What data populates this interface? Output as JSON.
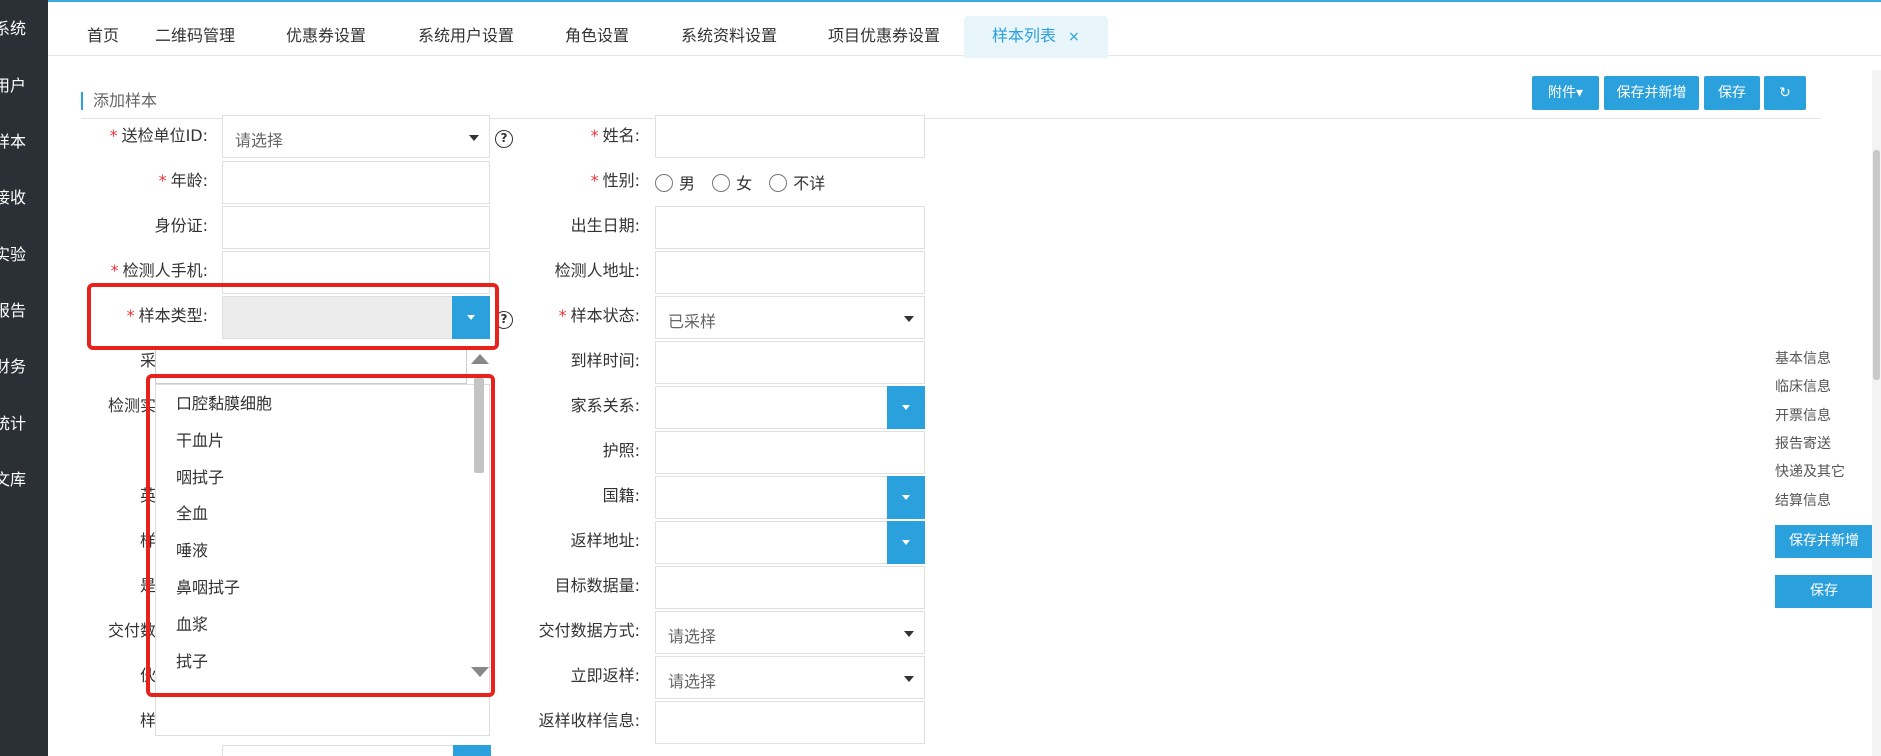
{
  "sidebar": {
    "items": [
      "系统",
      "用户",
      "样本",
      "接收",
      "实验",
      "报告",
      "财务",
      "统计",
      "文库"
    ]
  },
  "tabs": [
    {
      "label": "首页"
    },
    {
      "label": "二维码管理"
    },
    {
      "label": "优惠券设置"
    },
    {
      "label": "系统用户设置"
    },
    {
      "label": "角色设置"
    },
    {
      "label": "系统资料设置"
    },
    {
      "label": "项目优惠券设置"
    },
    {
      "label": "样本列表",
      "active": true,
      "close": "×"
    }
  ],
  "section_title": "添加样本",
  "toolbar": {
    "attachment": "附件▾",
    "save_new": "保存并新增",
    "save": "保存",
    "refresh_icon": "↻"
  },
  "left_form": {
    "unit_label": "送检单位ID:",
    "unit_value": "请选择",
    "age_label": "年龄:",
    "id_label": "身份证:",
    "phone_label": "检测人手机:",
    "sample_type_label": "样本类型:",
    "row6_partial": "采",
    "row7_partial": "检测实",
    "row9_partial": "英",
    "row10_partial": "样",
    "row11_partial": "是",
    "row12_partial": "交付数",
    "row13_partial": "伙",
    "row14_partial": "样"
  },
  "right_form": {
    "name_label": "姓名:",
    "gender_label": "性别:",
    "gender_options": [
      "男",
      "女",
      "不详"
    ],
    "birth_label": "出生日期:",
    "address_label": "检测人地址:",
    "status_label": "样本状态:",
    "status_value": "已采样",
    "arrival_label": "到样时间:",
    "family_label": "家系关系:",
    "passport_label": "护照:",
    "nationality_label": "国籍:",
    "return_addr_label": "返样地址:",
    "target_data_label": "目标数据量:",
    "delivery_label": "交付数据方式:",
    "delivery_value": "请选择",
    "immediate_label": "立即返样:",
    "immediate_value": "请选择",
    "return_info_label": "返样收样信息:"
  },
  "dropdown": {
    "options": [
      "口腔黏膜细胞",
      "干血片",
      "咽拭子",
      "全血",
      "唾液",
      "鼻咽拭子",
      "血浆",
      "拭子"
    ]
  },
  "right_nav": {
    "items": [
      "基本信息",
      "临床信息",
      "开票信息",
      "报告寄送",
      "快递及其它",
      "结算信息"
    ],
    "save_new": "保存并新增",
    "save": "保存"
  },
  "colors": {
    "accent": "#2aa0dc",
    "sidebar": "#2a3036",
    "highlight": "#e8211b",
    "required": "#e33333"
  }
}
